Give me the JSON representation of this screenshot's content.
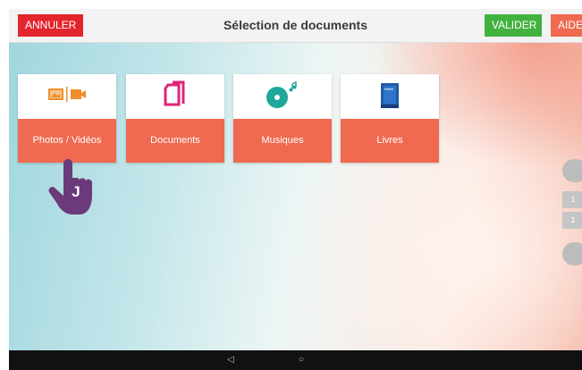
{
  "toolbar": {
    "cancel_label": "ANNULER",
    "title": "Sélection de documents",
    "validate_label": "VALIDER",
    "help_label": "AIDE"
  },
  "tiles": [
    {
      "label": "Photos / Vidéos",
      "icon": "photo-video-icon"
    },
    {
      "label": "Documents",
      "icon": "documents-icon"
    },
    {
      "label": "Musiques",
      "icon": "music-disc-icon"
    },
    {
      "label": "Livres",
      "icon": "book-icon"
    }
  ],
  "side": {
    "page_numbers": [
      "1",
      "1"
    ]
  },
  "pointer": {
    "letter": "J",
    "icon": "hand-pointer-icon"
  },
  "navbar": {
    "back_glyph": "◁",
    "home_glyph": "○"
  },
  "colors": {
    "cancel": "#e3262d",
    "validate": "#42b23f",
    "help": "#ef6a50",
    "tile_label": "#ef6a50",
    "pointer": "#6b3a7a"
  }
}
